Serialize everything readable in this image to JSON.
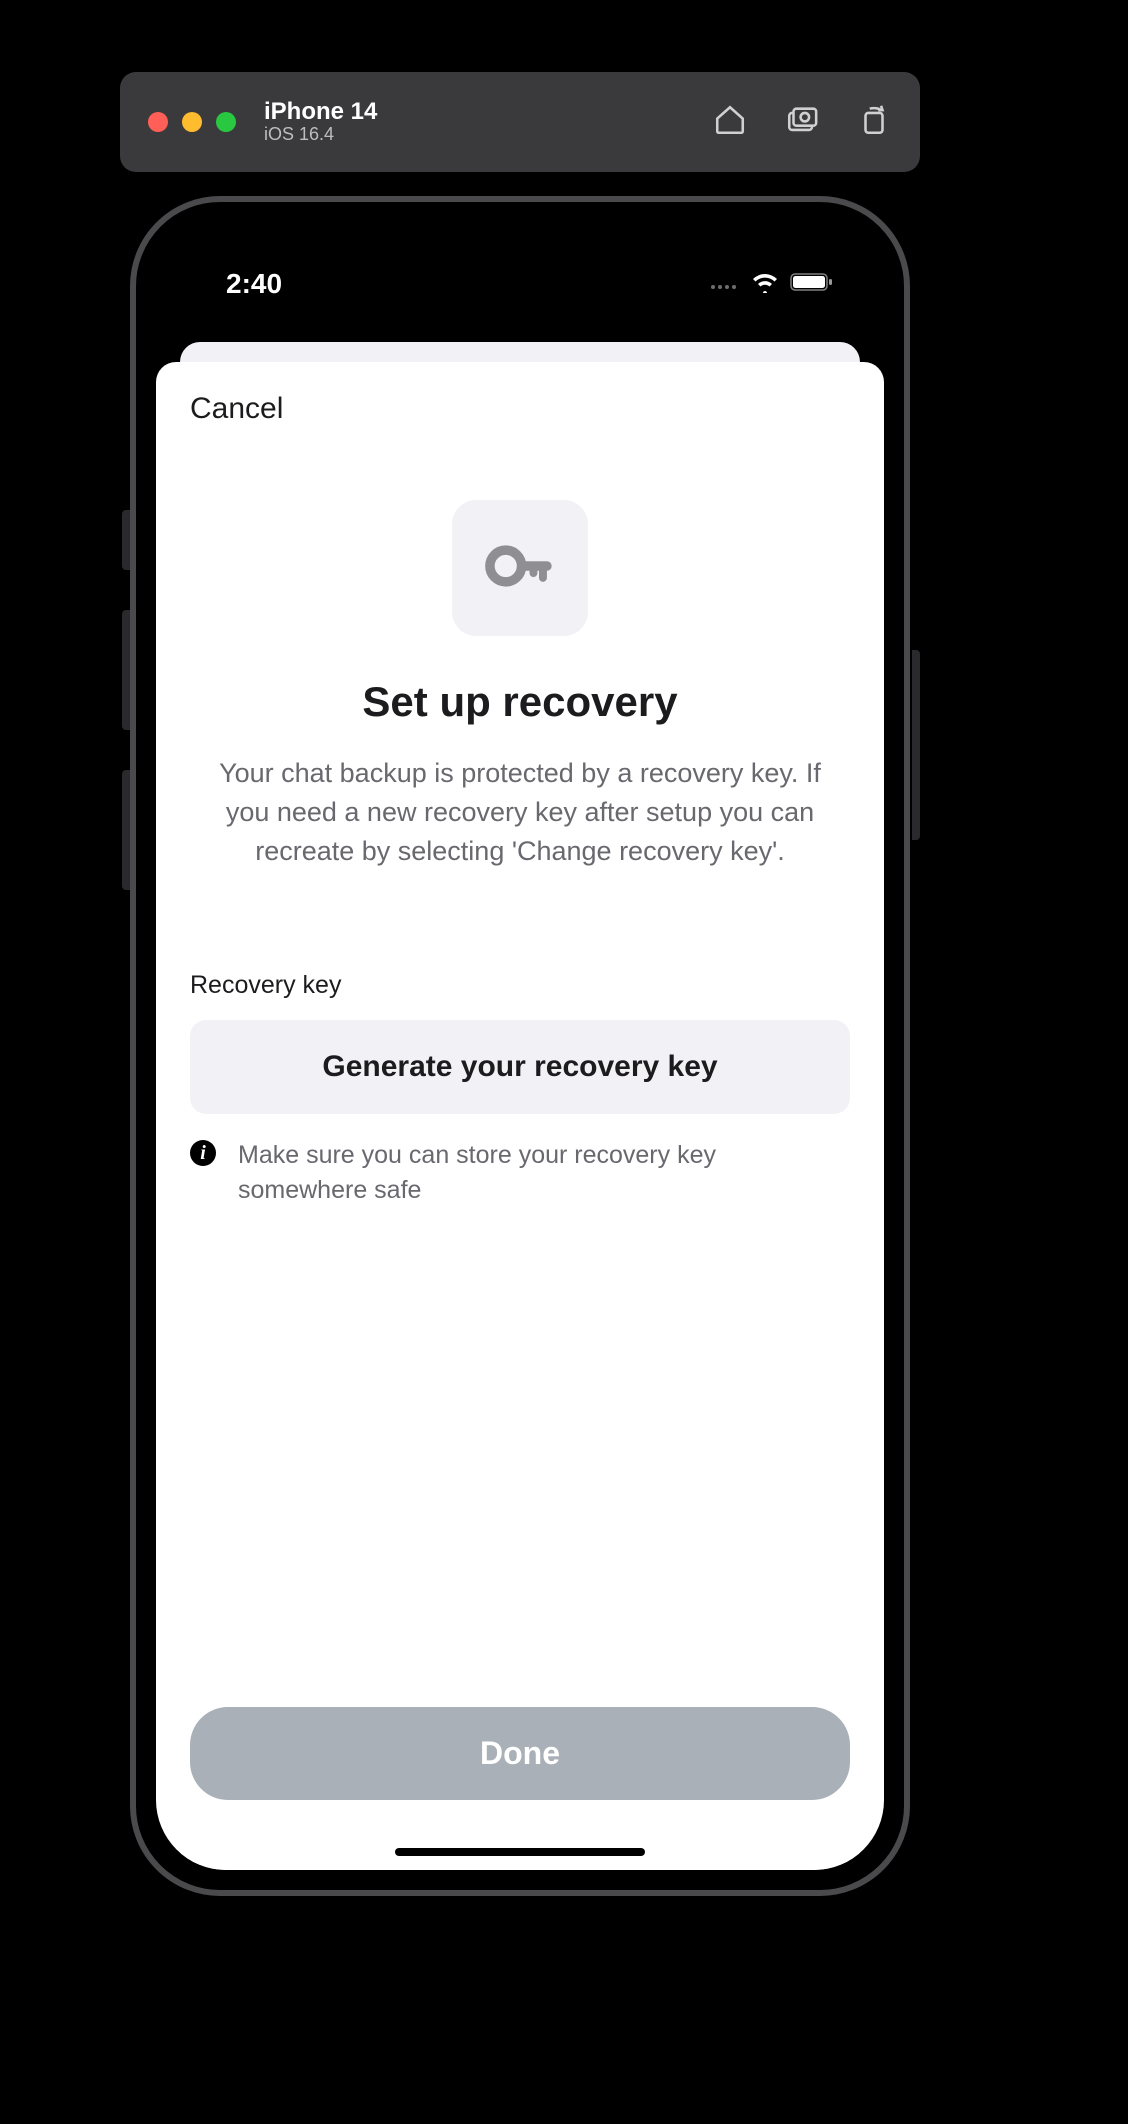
{
  "simulator": {
    "device_name": "iPhone 14",
    "os_version": "iOS 16.4"
  },
  "status": {
    "time": "2:40"
  },
  "sheet": {
    "cancel_label": "Cancel",
    "title": "Set up recovery",
    "description": "Your chat backup is protected by a recovery key. If you need a new recovery key after setup you can recreate by selecting 'Change recovery key'.",
    "section_label": "Recovery key",
    "generate_label": "Generate your recovery key",
    "hint": "Make sure you can store your recovery key somewhere safe",
    "done_label": "Done"
  }
}
